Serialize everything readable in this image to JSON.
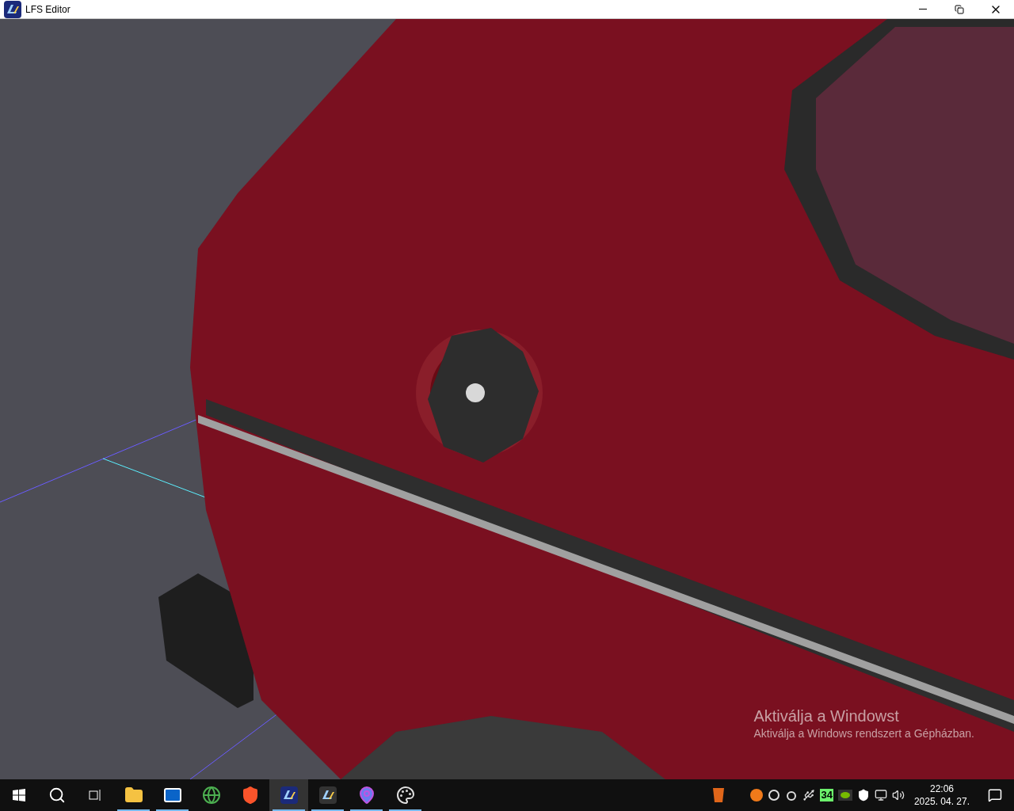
{
  "window": {
    "title": "LFS Editor"
  },
  "activation_notice": {
    "title": "Aktiválja a Windowst",
    "text": "Aktiválja a Windows rendszert a Gépházban."
  },
  "taskbar": {
    "apps": [
      {
        "kind": "explorer",
        "running": true,
        "selected": false
      },
      {
        "kind": "outlook",
        "running": true,
        "selected": false
      },
      {
        "kind": "chrome",
        "running": false,
        "selected": false
      },
      {
        "kind": "brave",
        "running": false,
        "selected": false
      },
      {
        "kind": "lfs",
        "running": true,
        "selected": true
      },
      {
        "kind": "lfs_dark",
        "running": true,
        "selected": false
      },
      {
        "kind": "pin",
        "running": true,
        "selected": false
      },
      {
        "kind": "paint",
        "running": true,
        "selected": false
      }
    ],
    "tray_badge": "34",
    "time": "22:06",
    "date": "2025. 04. 27."
  }
}
